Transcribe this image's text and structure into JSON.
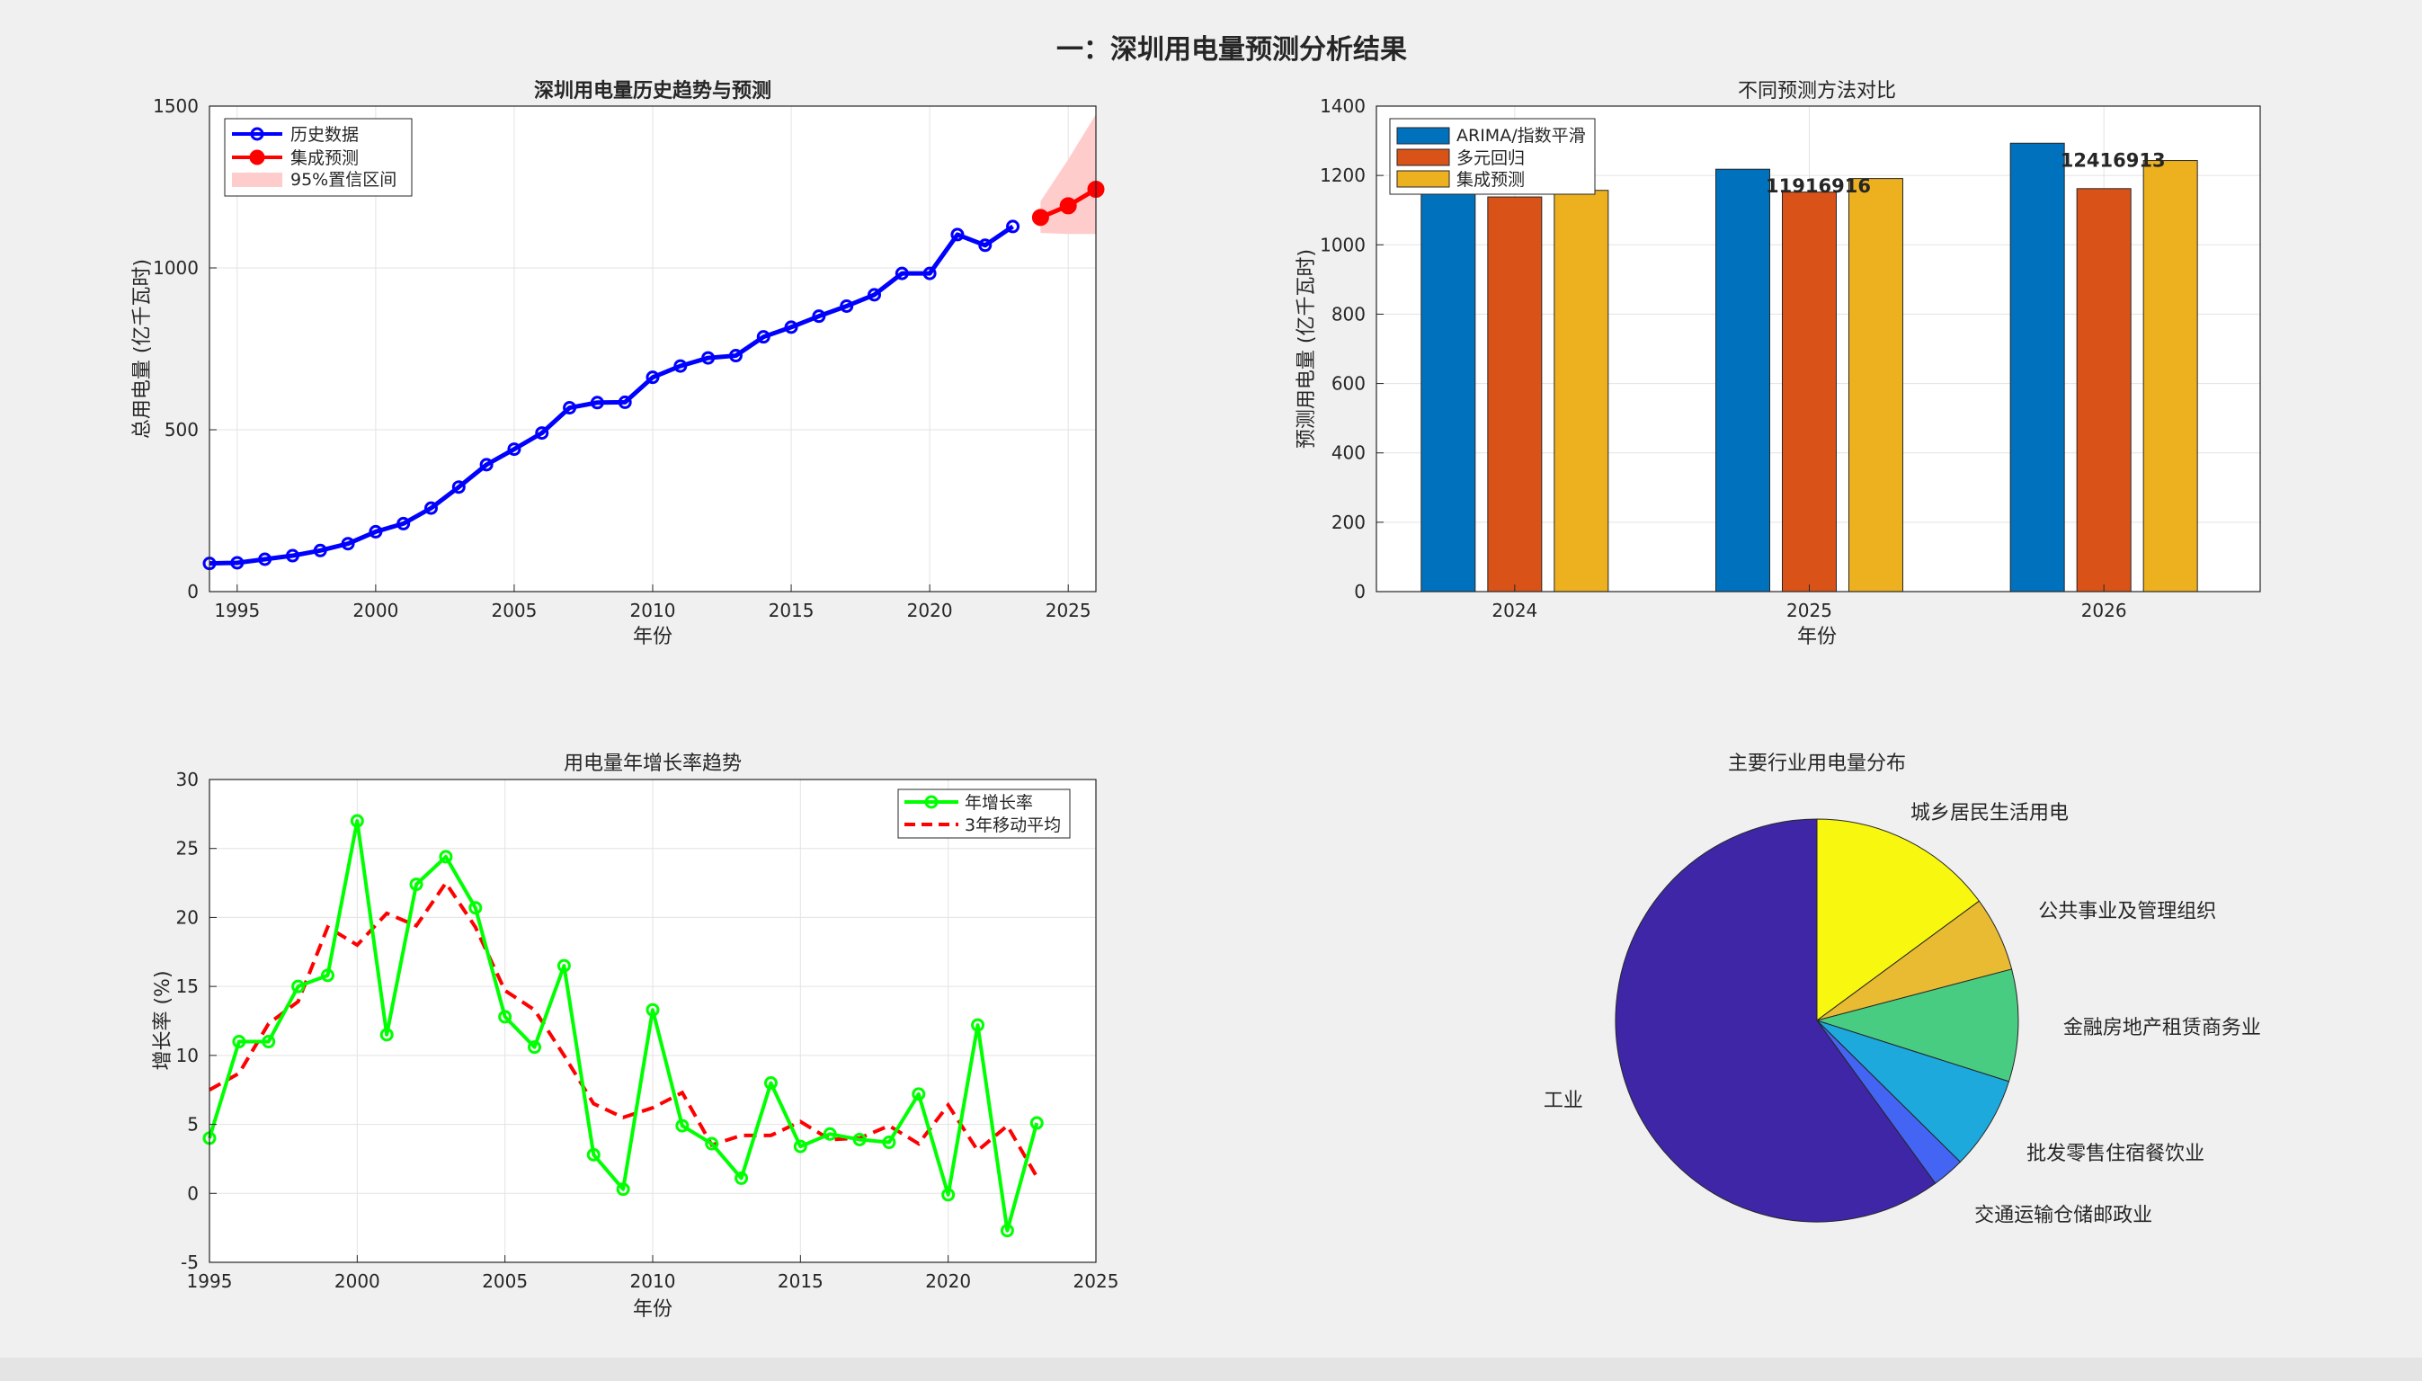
{
  "figure_title": "一：深圳用电量预测分析结果",
  "chart_data": [
    {
      "type": "line",
      "title": "深圳用电量历史趋势与预测",
      "xlabel": "年份",
      "ylabel": "总用电量 (亿千瓦时)",
      "xlim": [
        1994,
        2026
      ],
      "ylim": [
        0,
        1500
      ],
      "xticks": [
        "1995",
        "2000",
        "2005",
        "2010",
        "2015",
        "2020",
        "2025"
      ],
      "yticks": [
        "0",
        "500",
        "1000",
        "1500"
      ],
      "grid": true,
      "legend_position": "top-left",
      "series": [
        {
          "name": "历史数据",
          "color": "#0000ff",
          "x": [
            1994,
            1995,
            1996,
            1997,
            1998,
            1999,
            2000,
            2001,
            2002,
            2003,
            2004,
            2005,
            2006,
            2007,
            2008,
            2009,
            2010,
            2011,
            2012,
            2013,
            2014,
            2015,
            2016,
            2017,
            2018,
            2019,
            2020,
            2021,
            2022,
            2023
          ],
          "y": [
            87,
            89,
            100,
            111,
            127,
            148,
            185,
            210,
            258,
            323,
            392,
            440,
            490,
            568,
            584,
            585,
            662,
            697,
            722,
            729,
            787,
            817,
            851,
            882,
            917,
            983,
            983,
            1103,
            1070,
            1128
          ]
        },
        {
          "name": "集成预测",
          "color": "#ff0000",
          "x": [
            2024,
            2025,
            2026
          ],
          "y": [
            1156,
            1192,
            1243
          ]
        }
      ],
      "band": {
        "name": "95%置信区间",
        "color": "#ffcccc",
        "x": [
          2024,
          2025,
          2026
        ],
        "lower": [
          1108,
          1105,
          1105
        ],
        "upper": [
          1206,
          1335,
          1475
        ]
      }
    },
    {
      "type": "bar",
      "title": "不同预测方法对比",
      "xlabel": "年份",
      "ylabel": "预测用电量 (亿千瓦时)",
      "ylim": [
        0,
        1400
      ],
      "yticks": [
        "0",
        "200",
        "400",
        "600",
        "800",
        "1000",
        "1200",
        "1400"
      ],
      "categories": [
        "2024",
        "2025",
        "2026"
      ],
      "grid": true,
      "legend_position": "top-left",
      "series": [
        {
          "name": "ARIMA/指数平滑",
          "color": "#0072bd",
          "values": [
            1155,
            1218,
            1293
          ]
        },
        {
          "name": "多元回归",
          "color": "#d95319",
          "values": [
            1138,
            1152,
            1162
          ]
        },
        {
          "name": "集成预测",
          "color": "#edb120",
          "values": [
            1157,
            1191,
            1243
          ]
        }
      ],
      "annotations": [
        {
          "category": "2025",
          "text": "11916916"
        },
        {
          "category": "2026",
          "text": "12416913"
        }
      ]
    },
    {
      "type": "line",
      "title": "用电量年增长率趋势",
      "xlabel": "年份",
      "ylabel": "增长率 (%)",
      "xlim": [
        1995,
        2025
      ],
      "ylim": [
        -5,
        30
      ],
      "xticks": [
        "1995",
        "2000",
        "2005",
        "2010",
        "2015",
        "2020",
        "2025"
      ],
      "yticks": [
        "-5",
        "0",
        "5",
        "10",
        "15",
        "20",
        "25",
        "30"
      ],
      "grid": true,
      "legend_position": "top-right",
      "series": [
        {
          "name": "年增长率",
          "color": "#00ff00",
          "x": [
            1995,
            1996,
            1997,
            1998,
            1999,
            2000,
            2001,
            2002,
            2003,
            2004,
            2005,
            2006,
            2007,
            2008,
            2009,
            2010,
            2011,
            2012,
            2013,
            2014,
            2015,
            2016,
            2017,
            2018,
            2019,
            2020,
            2021,
            2022,
            2023
          ],
          "y": [
            4,
            11,
            11,
            15,
            15.8,
            27,
            11.5,
            22.4,
            24.4,
            20.7,
            12.8,
            10.6,
            16.5,
            2.8,
            0.3,
            13.3,
            4.9,
            3.6,
            1.1,
            8,
            3.4,
            4.3,
            3.9,
            3.7,
            7.2,
            -0.1,
            12.2,
            -2.7,
            5.1
          ]
        },
        {
          "name": "3年移动平均",
          "color": "#ff0000",
          "dashed": true,
          "x": [
            1995,
            1996,
            1997,
            1998,
            1999,
            2000,
            2001,
            2002,
            2003,
            2004,
            2005,
            2006,
            2007,
            2008,
            2009,
            2010,
            2011,
            2012,
            2013,
            2014,
            2015,
            2016,
            2017,
            2018,
            2019,
            2020,
            2021,
            2022,
            2023
          ],
          "y": [
            7.5,
            8.7,
            12.3,
            13.9,
            19.3,
            18,
            20.3,
            19.4,
            22.5,
            19.3,
            14.7,
            13.3,
            10,
            6.5,
            5.5,
            6.2,
            7.3,
            3.5,
            4.2,
            4.2,
            5.2,
            3.9,
            4,
            4.9,
            3.6,
            6.4,
            3.1,
            4.9,
            1.2
          ]
        }
      ]
    },
    {
      "type": "pie",
      "title": "主要行业用电量分布",
      "slices": [
        {
          "label": "城乡居民生活用电",
          "value": 14.9,
          "color": "#f7f70f"
        },
        {
          "label": "公共事业及管理组织",
          "value": 6.0,
          "color": "#e8bb32"
        },
        {
          "label": "金融房地产租赁商务业",
          "value": 9.0,
          "color": "#48cc82"
        },
        {
          "label": "批发零售住宿餐饮业",
          "value": 7.5,
          "color": "#1da9dc"
        },
        {
          "label": "交通运输仓储邮政业",
          "value": 2.6,
          "color": "#4464f4"
        },
        {
          "label": "工业",
          "value": 60.0,
          "color": "#3f26a6"
        }
      ]
    }
  ]
}
